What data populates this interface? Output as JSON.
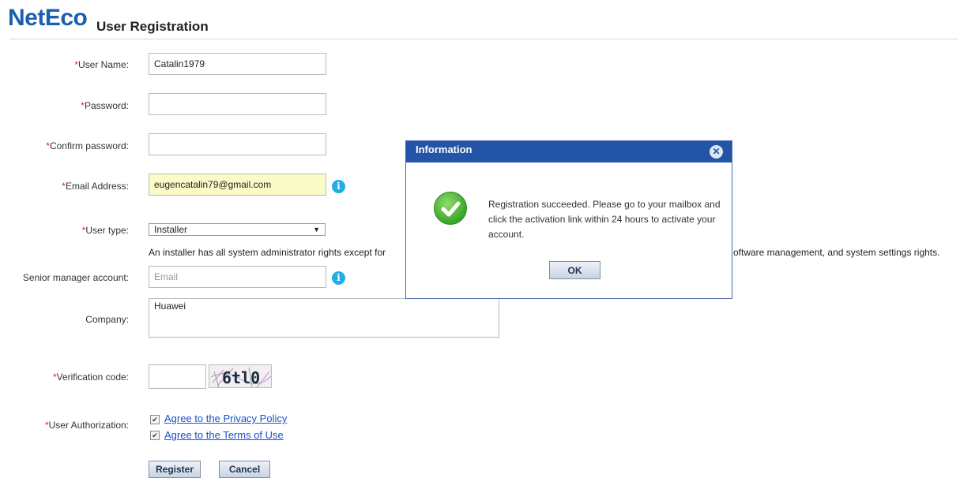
{
  "header": {
    "logo": "NetEco",
    "title": "User Registration"
  },
  "form": {
    "username": {
      "label": "User Name:",
      "value": "Catalin1979"
    },
    "password": {
      "label": "Password:",
      "value": ""
    },
    "confirm_password": {
      "label": "Confirm password:",
      "value": ""
    },
    "email": {
      "label": "Email Address:",
      "value": "eugencatalin79@gmail.com"
    },
    "user_type": {
      "label": "User type:",
      "selected": "Installer",
      "description_left": "An installer has all system administrator rights except for",
      "description_right": "oftware management, and system settings rights."
    },
    "senior_manager": {
      "label": "Senior manager account:",
      "placeholder": "Email"
    },
    "company": {
      "label": "Company:",
      "value": "Huawei"
    },
    "verification": {
      "label": "Verification code:",
      "value": "",
      "captcha_text": "6tl0"
    },
    "authorization": {
      "label": "User Authorization:",
      "privacy_label": "Agree to the Privacy Policy",
      "privacy_checked": true,
      "terms_label": "Agree to the Terms of Use",
      "terms_checked": true
    },
    "required_marker": "*",
    "register_label": "Register",
    "cancel_label": "Cancel"
  },
  "dialog": {
    "title": "Information",
    "message": "Registration succeeded. Please go to your mailbox and click the activation link within 24 hours to activate your account.",
    "ok_label": "OK"
  },
  "colors": {
    "brand": "#1b5fae",
    "dialog_header": "#2354a8",
    "required": "#e02020",
    "link": "#1a4fcf",
    "info_icon": "#1eaee8"
  }
}
